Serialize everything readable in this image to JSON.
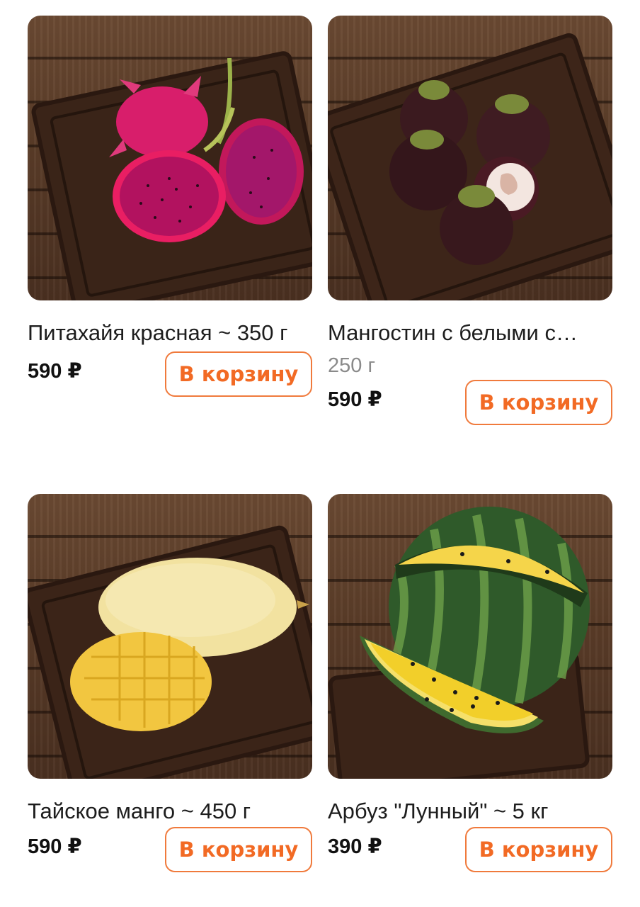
{
  "products": [
    {
      "name": "Питахайя красная ~ 350 г",
      "weight": "",
      "price": "590 ₽",
      "button": "В корзину",
      "image": "dragon-fruit-image"
    },
    {
      "name": "Мангостин с белыми с…",
      "weight": "250 г",
      "price": "590 ₽",
      "button": "В корзину",
      "image": "mangosteen-image"
    },
    {
      "name": "Тайское манго ~ 450 г",
      "weight": "",
      "price": "590 ₽",
      "button": "В корзину",
      "image": "mango-image"
    },
    {
      "name": "Арбуз \"Лунный\" ~ 5 кг",
      "weight": "",
      "price": "390 ₽",
      "button": "В корзину",
      "image": "watermelon-image"
    }
  ],
  "colors": {
    "accent": "#f26a24",
    "accent_border": "#f07a3c",
    "muted_text": "#8a8a8a"
  }
}
